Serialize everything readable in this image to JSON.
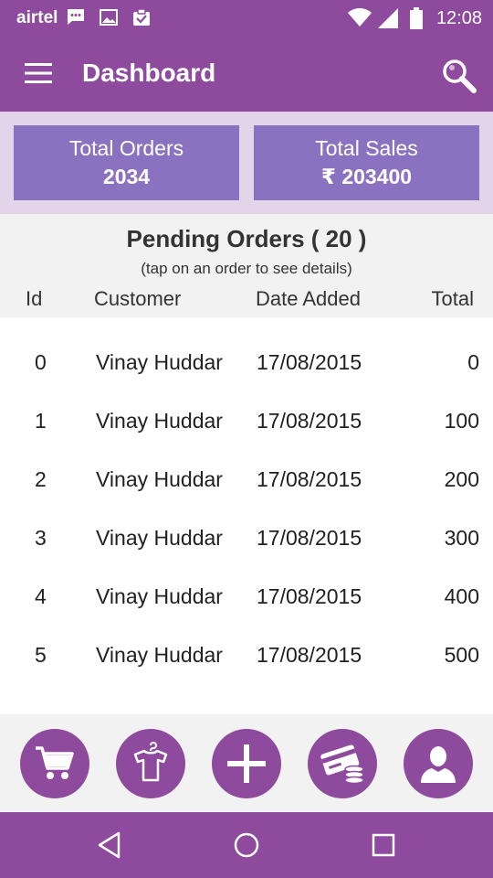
{
  "status_bar": {
    "carrier": "airtel",
    "time": "12:08"
  },
  "app_bar": {
    "title": "Dashboard"
  },
  "stats": {
    "total_orders_label": "Total Orders",
    "total_orders_value": "2034",
    "total_sales_label": "Total Sales",
    "total_sales_value": "₹ 203400"
  },
  "pending": {
    "heading": "Pending Orders ( 20 )",
    "hint": "(tap on an order to see details)",
    "columns": [
      "Id",
      "Customer",
      "Date Added",
      "Total"
    ],
    "rows": [
      {
        "id": "0",
        "customer": "Vinay Huddar",
        "date": "17/08/2015",
        "total": "0"
      },
      {
        "id": "1",
        "customer": "Vinay Huddar",
        "date": "17/08/2015",
        "total": "100"
      },
      {
        "id": "2",
        "customer": "Vinay Huddar",
        "date": "17/08/2015",
        "total": "200"
      },
      {
        "id": "3",
        "customer": "Vinay Huddar",
        "date": "17/08/2015",
        "total": "300"
      },
      {
        "id": "4",
        "customer": "Vinay Huddar",
        "date": "17/08/2015",
        "total": "400"
      },
      {
        "id": "5",
        "customer": "Vinay Huddar",
        "date": "17/08/2015",
        "total": "500"
      }
    ]
  },
  "bottom_nav": {
    "icons": [
      "cart-icon",
      "shirt-icon",
      "plus-icon",
      "payment-icon",
      "user-icon"
    ]
  },
  "system_nav": {
    "icons": [
      "back-icon",
      "home-icon",
      "recents-icon"
    ]
  },
  "colors": {
    "primary": "#8e4b9e",
    "card": "#8a72c0",
    "band": "#e4d4ea",
    "surface": "#f2f2f2"
  }
}
